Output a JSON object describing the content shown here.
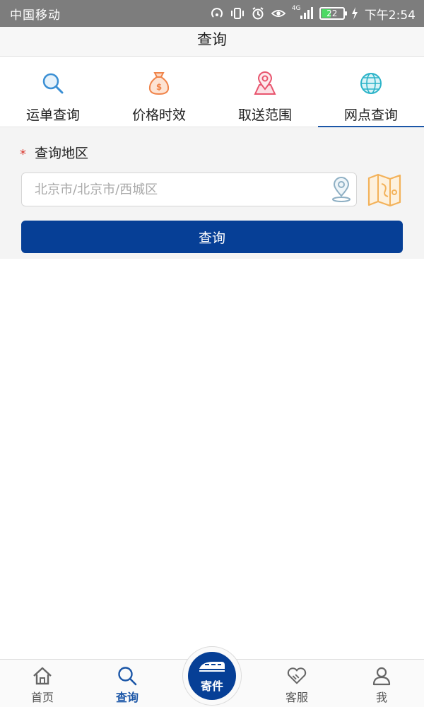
{
  "status_bar": {
    "carrier": "中国移动",
    "network": "4G",
    "battery": "22",
    "time": "下午2:54"
  },
  "nav": {
    "title": "查询"
  },
  "tabs": [
    {
      "label": "运单查询",
      "icon": "search-icon",
      "color": "#3a8fd4"
    },
    {
      "label": "价格时效",
      "icon": "money-bag-icon",
      "color": "#f0844a"
    },
    {
      "label": "取送范围",
      "icon": "location-range-icon",
      "color": "#e8556e"
    },
    {
      "label": "网点查询",
      "icon": "globe-icon",
      "color": "#2bb3c8",
      "active": true
    }
  ],
  "form": {
    "field_label": "查询地区",
    "required_mark": "*",
    "region_placeholder": "北京市/北京市/西城区",
    "query_button": "查询"
  },
  "bottom_nav": {
    "items": [
      {
        "label": "首页",
        "icon": "home-icon"
      },
      {
        "label": "查询",
        "icon": "search-icon",
        "active": true
      },
      {
        "label": "客服",
        "icon": "handshake-icon"
      },
      {
        "label": "我",
        "icon": "user-icon"
      }
    ],
    "center": {
      "label": "寄件",
      "icon": "train-icon"
    }
  },
  "colors": {
    "primary": "#063f96",
    "active_tab": "#1b56a7",
    "required": "#d9342b"
  }
}
